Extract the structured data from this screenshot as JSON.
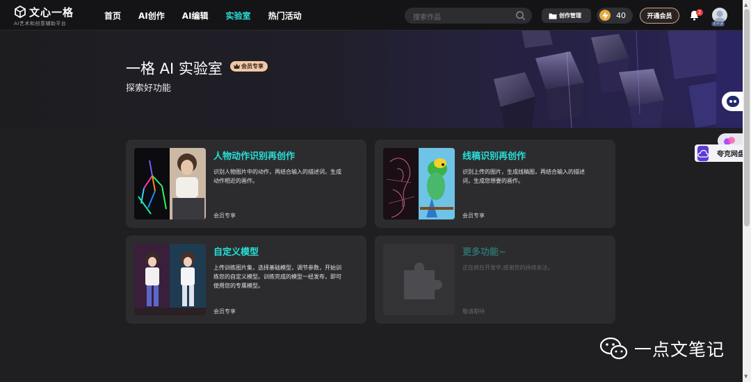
{
  "header": {
    "logo_title": "文心一格",
    "logo_subtitle": "AI艺术和创意辅助平台",
    "nav": [
      {
        "label": "首页",
        "active": false
      },
      {
        "label": "AI创作",
        "active": false
      },
      {
        "label": "AI编辑",
        "active": false
      },
      {
        "label": "实验室",
        "active": true
      },
      {
        "label": "热门活动",
        "active": false
      }
    ],
    "search_placeholder": "搜索作品",
    "create_manage_label": "创作管理",
    "points_value": "40",
    "vip_button_label": "开通会员",
    "notification_count": "2",
    "avatar_label": "未开通"
  },
  "banner": {
    "title": "一格 AI 实验室",
    "badge": "会员专享",
    "subtitle": "探索好功能"
  },
  "cards": [
    {
      "title": "人物动作识别再创作",
      "description": "识别人物图片中的动作，再结合输入的描述词，生成动作相近的画作。",
      "tag": "会员专享"
    },
    {
      "title": "线稿识别再创作",
      "description": "识别上传的图片，生成线稿图，再结合输入的描述词，生成您想要的画作。",
      "tag": "会员专享"
    },
    {
      "title": "自定义模型",
      "description": "上传训练图片集，选择基础模型，调节参数，开始训练您的自定义模型。训练完成的模型一经发布，即可使用您的专属模型。",
      "tag": "会员专享"
    },
    {
      "title": "更多功能~",
      "description": "正在疯狂开发中,感谢您的持续关注。",
      "tag": "敬请期待"
    }
  ],
  "side": {
    "netdisk_label": "夸克网盘"
  },
  "watermark": {
    "text": "一点文笔记"
  },
  "colors": {
    "accent": "#27e0d7",
    "background": "#1f1f21",
    "card": "#2c2c2f",
    "badge": "#f1c8a7"
  }
}
